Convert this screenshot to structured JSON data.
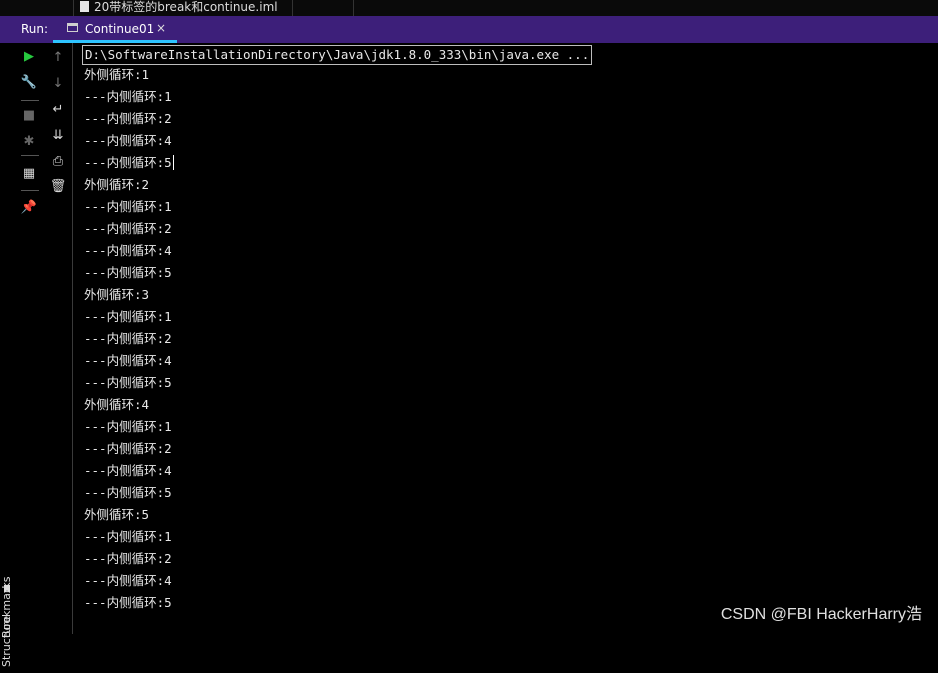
{
  "top_tab": {
    "filename": "20带标签的break和continue.iml"
  },
  "run_panel": {
    "label": "Run:",
    "tab_title": "Continue01",
    "close_symbol": "×"
  },
  "left_tools": [
    {
      "name": "rerun-icon",
      "glyph": "▶",
      "color": "#27c93f"
    },
    {
      "name": "wrench-icon",
      "glyph": "🔧",
      "color": "#d8d8d8"
    },
    {
      "name": "stop-icon",
      "glyph": "■",
      "color": "#666666"
    },
    {
      "name": "debug-icon",
      "glyph": "✱",
      "color": "#666666"
    },
    {
      "name": "layout-icon",
      "glyph": "▦",
      "color": "#d8d8d8"
    },
    {
      "name": "pin-icon",
      "glyph": "📌",
      "color": "#d8d8d8"
    }
  ],
  "console_tools": [
    {
      "name": "up-arrow-icon",
      "glyph": "↑",
      "color": "#777777"
    },
    {
      "name": "down-arrow-icon",
      "glyph": "↓",
      "color": "#777777"
    },
    {
      "name": "soft-wrap-icon",
      "glyph": "↵",
      "color": "#d8d8d8"
    },
    {
      "name": "scroll-to-end-icon",
      "glyph": "⇊",
      "color": "#d8d8d8"
    },
    {
      "name": "print-icon",
      "glyph": "⎙",
      "color": "#d8d8d8"
    },
    {
      "name": "trash-icon",
      "glyph": "🗑",
      "color": "#d8d8d8"
    }
  ],
  "side_tabs": {
    "bookmarks": "Bookmarks",
    "structure": "Structure"
  },
  "console": {
    "command": "D:\\SoftwareInstallationDirectory\\Java\\jdk1.8.0_333\\bin\\java.exe ...",
    "lines": [
      "外侧循环:1",
      "---内侧循环:1",
      "---内侧循环:2",
      "---内侧循环:4",
      "---内侧循环:5",
      "外侧循环:2",
      "---内侧循环:1",
      "---内侧循环:2",
      "---内侧循环:4",
      "---内侧循环:5",
      "外侧循环:3",
      "---内侧循环:1",
      "---内侧循环:2",
      "---内侧循环:4",
      "---内侧循环:5",
      "外侧循环:4",
      "---内侧循环:1",
      "---内侧循环:2",
      "---内侧循环:4",
      "---内侧循环:5",
      "外侧循环:5",
      "---内侧循环:1",
      "---内侧循环:2",
      "---内侧循环:4",
      "---内侧循环:5"
    ]
  },
  "watermark": "CSDN @FBI HackerHarry浩"
}
